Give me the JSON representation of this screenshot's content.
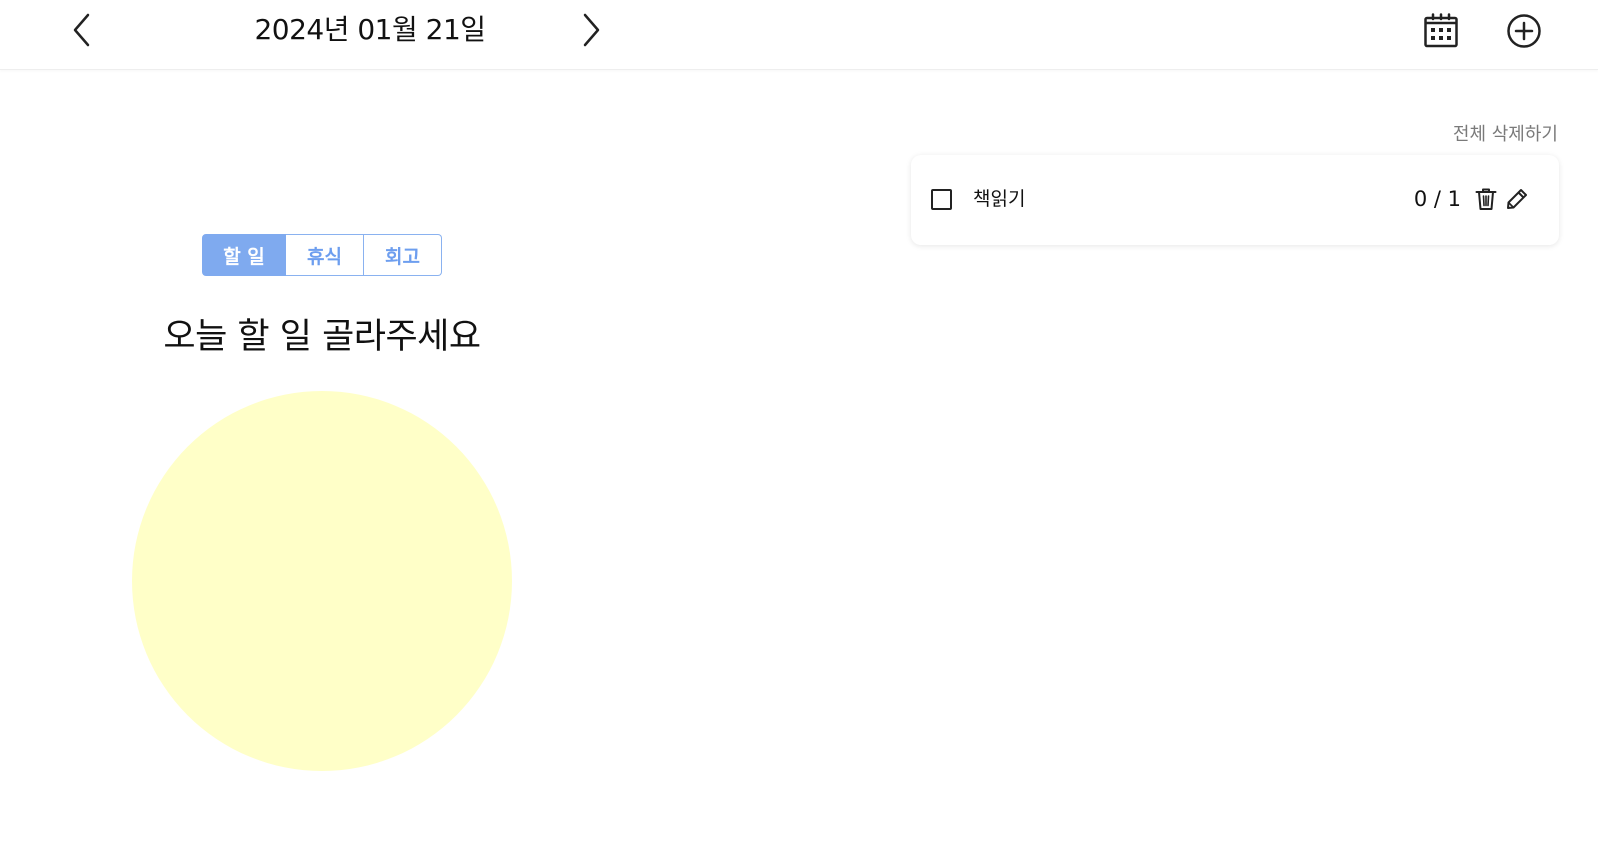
{
  "header": {
    "date": "2024년 01월 21일",
    "prev_icon": "chevron-left-icon",
    "next_icon": "chevron-right-icon",
    "calendar_icon": "calendar-icon",
    "add_icon": "plus-circle-icon"
  },
  "tabs": [
    {
      "label": "할 일",
      "active": true
    },
    {
      "label": "휴식",
      "active": false
    },
    {
      "label": "회고",
      "active": false
    }
  ],
  "prompt": "오늘 할 일 골라주세요",
  "task_list": {
    "delete_all_label": "전체 삭제하기",
    "items": [
      {
        "label": "책읽기",
        "checked": false,
        "progress": "0 / 1"
      }
    ]
  },
  "colors": {
    "tab_accent": "#7faaef",
    "circle_fill": "#ffffc8"
  }
}
